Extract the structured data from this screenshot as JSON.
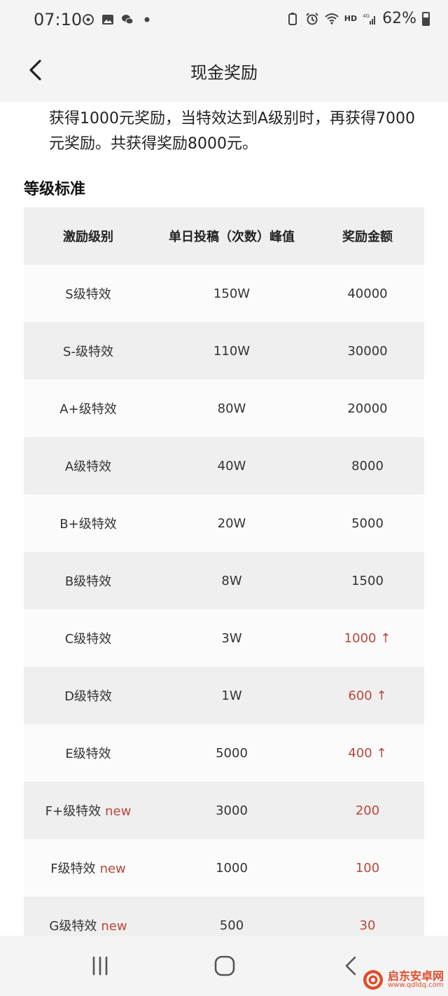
{
  "status": {
    "time": "07:10",
    "battery": "62%",
    "network": "4G",
    "hd": "HD"
  },
  "header": {
    "title": "现金奖励"
  },
  "intro_text": "获得1000元奖励，当特效达到A级别时，再获得7000元奖励。共获得奖励8000元。",
  "section_title": "等级标准",
  "table": {
    "headers": [
      "激励级别",
      "单日投稿（次数）峰值",
      "奖励金额"
    ],
    "new_label": "new",
    "up_arrow": "↑",
    "rows": [
      {
        "level": "S级特效",
        "peak": "150W",
        "reward": "40000"
      },
      {
        "level": "S-级特效",
        "peak": "110W",
        "reward": "30000"
      },
      {
        "level": "A+级特效",
        "peak": "80W",
        "reward": "20000"
      },
      {
        "level": "A级特效",
        "peak": "40W",
        "reward": "8000"
      },
      {
        "level": "B+级特效",
        "peak": "20W",
        "reward": "5000"
      },
      {
        "level": "B级特效",
        "peak": "8W",
        "reward": "1500"
      },
      {
        "level": "C级特效",
        "peak": "3W",
        "reward": "1000"
      },
      {
        "level": "D级特效",
        "peak": "1W",
        "reward": "600"
      },
      {
        "level": "E级特效",
        "peak": "5000",
        "reward": "400"
      },
      {
        "level": "F+级特效",
        "peak": "3000",
        "reward": "200"
      },
      {
        "level": "F级特效",
        "peak": "1000",
        "reward": "100"
      },
      {
        "level": "G级特效",
        "peak": "500",
        "reward": "30"
      }
    ]
  },
  "watermark": {
    "name": "启东安卓网",
    "url": "www.qdldq.com"
  },
  "colors": {
    "accent_red": "#b9473b",
    "bar_bg": "#f4f4f4",
    "row_alt": "#efefef"
  }
}
